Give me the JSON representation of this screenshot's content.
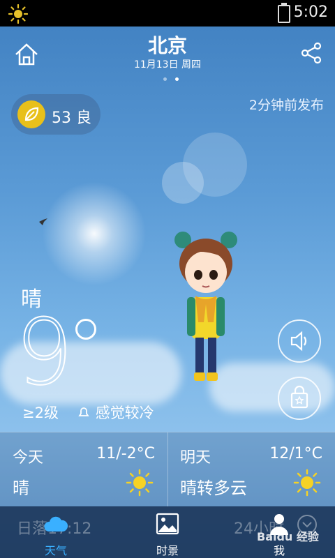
{
  "status_bar": {
    "time": "5:02",
    "left_icon": "sun-icon",
    "battery_icon": "battery-charging-icon"
  },
  "header": {
    "city": "北京",
    "date": "11月13日 周四",
    "home_icon": "home-icon",
    "share_icon": "share-icon",
    "pages": 2,
    "active_page": 2
  },
  "air_quality": {
    "value": "53 良",
    "icon": "leaf-icon"
  },
  "publish_time": "2分钟前发布",
  "current": {
    "condition": "晴",
    "temperature": "9",
    "wind": "≥2级",
    "feel": "感觉较冷"
  },
  "side_buttons": {
    "sound_icon": "speaker-icon",
    "bag_icon": "shopping-bag-icon"
  },
  "forecast": [
    {
      "day": "今天",
      "range": "11/-2°C",
      "condition": "晴",
      "icon": "sun-icon"
    },
    {
      "day": "明天",
      "range": "12/1°C",
      "condition": "晴转多云",
      "icon": "sun-icon"
    }
  ],
  "tabbar": {
    "background_left": "日落17:12",
    "background_right": "24小时",
    "tabs": [
      {
        "label": "天气",
        "icon": "cloud-icon",
        "active": true
      },
      {
        "label": "时景",
        "icon": "picture-icon",
        "active": false
      },
      {
        "label": "我",
        "icon": "person-icon",
        "active": false
      }
    ]
  },
  "watermark": "Baidu 经验",
  "colors": {
    "accent_active": "#3ab0ff",
    "sun_yellow": "#f5d225",
    "leaf_badge": "#e8c01a"
  }
}
